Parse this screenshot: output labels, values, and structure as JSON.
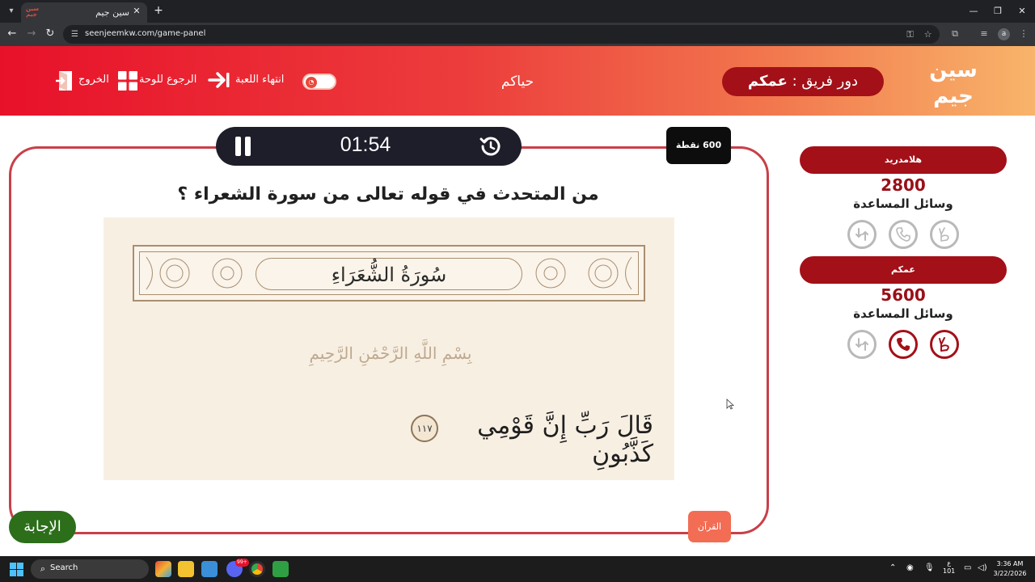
{
  "browser": {
    "tab_title": "سين جيم",
    "url": "seenjeemkw.com/game-panel",
    "profile_initial": "a"
  },
  "header": {
    "turn_prefix": "دور فريق :",
    "turn_team": "عمكم",
    "welcome": "حياكم",
    "end_game": "انتهاء اللعبة",
    "back_to_board": "الرجوع للوحة",
    "exit": "الخروج"
  },
  "question_panel": {
    "points": "600 نقطة",
    "timer": "01:54",
    "question": "من المتحدث في قوله تعالى من سورة الشعراء ؟",
    "answer_button": "الإجابة",
    "category": "القرآن",
    "quran_image": {
      "surah_name": "سُورَةُ الشُّعَرَاءِ",
      "basmala": "بِسْمِ اللَّهِ الرَّحْمَٰنِ الرَّحِيمِ",
      "verse": "قَالَ رَبِّ إِنَّ قَوْمِي كَذَّبُونِ",
      "verse_number": "١١٧"
    }
  },
  "teams": [
    {
      "name": "هلامدريد",
      "score": "2800",
      "help_label": "وسائل المساعدة",
      "active": false
    },
    {
      "name": "عمكم",
      "score": "5600",
      "help_label": "وسائل المساعدة",
      "active": true
    }
  ],
  "lifelines": [
    "two-fingers-icon",
    "phone-icon",
    "swap-icon"
  ],
  "colors": {
    "brand_red": "#a31018",
    "header_gradient_start": "#e8112a",
    "header_gradient_end": "#f8b46a",
    "frame_border": "#c8404a",
    "answer_green": "#2c6e1a",
    "category_orange": "#f26d54"
  },
  "taskbar": {
    "search_placeholder": "Search",
    "discord_badge": "99+",
    "time": "3:36 AM",
    "date": "3/22/2026",
    "weather": "101"
  }
}
